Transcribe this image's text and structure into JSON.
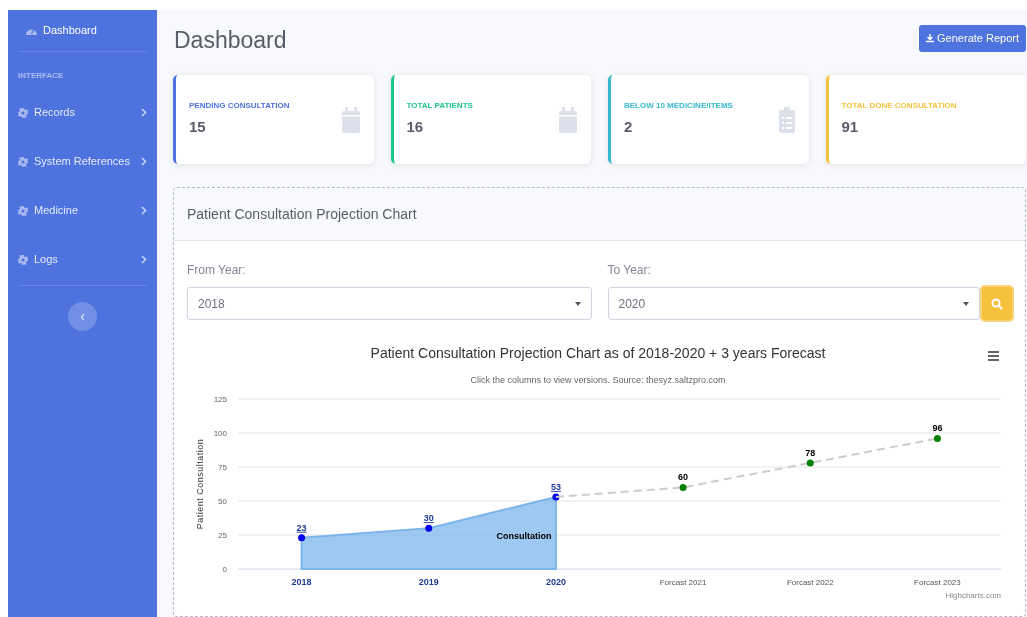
{
  "sidebar": {
    "brand": {
      "label": "Dashboard",
      "selected": true
    },
    "heading": "INTERFACE",
    "items": [
      {
        "label": "Records",
        "expanded": false
      },
      {
        "label": "System References",
        "expanded": false
      },
      {
        "label": "Medicine",
        "expanded": false
      },
      {
        "label": "Logs",
        "expanded": false
      }
    ],
    "toggle": "‹"
  },
  "page_title": "Dashboard",
  "report_button": "Generate Report",
  "cards": [
    {
      "label": "PENDING CONSULTATION",
      "value": "15",
      "color": "#4e73df",
      "kind": "calendar"
    },
    {
      "label": "TOTAL PATIENTS",
      "value": "16",
      "color": "#1cc88a",
      "kind": "calendar"
    },
    {
      "label": "BELOW 10 MEDICINE/ITEMS",
      "value": "2",
      "color": "#36b9cc",
      "kind": "clipboard"
    },
    {
      "label": "TOTAL DONE CONSULTATION",
      "value": "91",
      "color": "#f6c23e",
      "kind": "plain"
    }
  ],
  "chart_panel": {
    "title": "Patient Consultation Projection Chart",
    "from_year": {
      "label": "From Year:",
      "value": "2018"
    },
    "to_year": {
      "label": "To Year:",
      "value": "2020"
    },
    "chart_data": {
      "type": "area",
      "title": "Patient Consultation Projection Chart as of 2018-2020 + 3 years Forecast",
      "subtitle": "Click the columns to view versions. Source: thesyz.saltzpro.com",
      "ylabel": "Patient Consultation",
      "categories": [
        "2018",
        "2019",
        "2020",
        "Forcast 2021",
        "Forcast 2022",
        "Forcast 2023"
      ],
      "series": [
        {
          "name": "Consultation",
          "color": "#7cb5ec",
          "values": [
            23,
            30,
            53,
            null,
            null,
            null
          ],
          "value_labels": [
            "23",
            "30",
            "53",
            null,
            null,
            null
          ]
        },
        {
          "type": "line",
          "color": "#cccccc",
          "line_style": "dashed",
          "marker": true,
          "values": [
            null,
            null,
            53,
            60,
            78,
            96
          ],
          "value_labels": [
            null,
            null,
            null,
            "60",
            "78",
            "96"
          ]
        }
      ],
      "ylim": [
        0,
        125
      ],
      "grid": true,
      "yticks": [
        0,
        25,
        50,
        75,
        100,
        125
      ]
    },
    "credits": "Highcharts.com"
  }
}
